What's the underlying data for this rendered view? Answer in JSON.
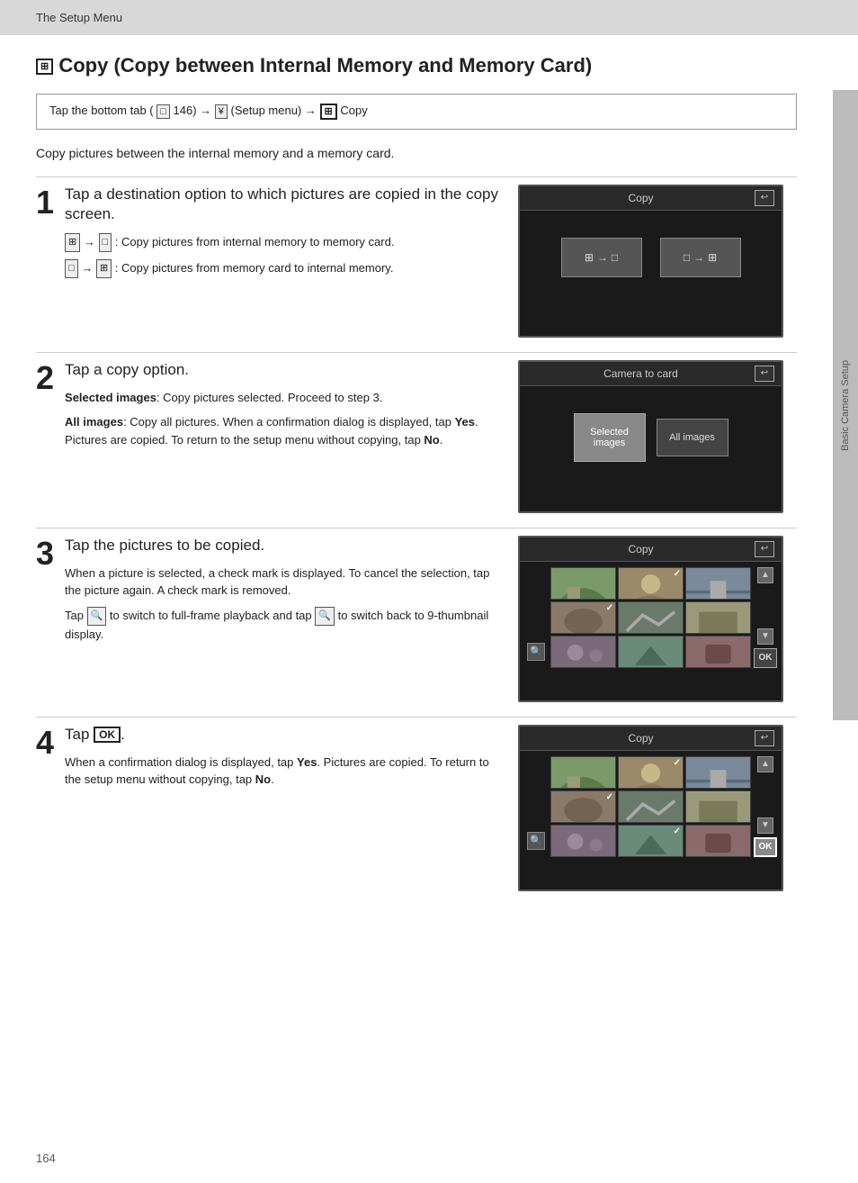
{
  "topBar": {
    "label": "The Setup Menu"
  },
  "page": {
    "title": "Copy (Copy between Internal Memory and Memory Card)",
    "titleIcon": "⊞",
    "instructionBox": "Tap the bottom tab (□ 146) → ¥ (Setup menu) → ⊞ Copy",
    "description": "Copy pictures between the internal memory and a memory card.",
    "sidebar": {
      "label": "Basic Camera Setup"
    },
    "pageNumber": "164"
  },
  "steps": [
    {
      "number": "1",
      "title": "Tap a destination option to which pictures are copied in the copy screen.",
      "descriptions": [
        "⊞ → □: Copy pictures from internal memory to memory card.",
        "□ → ⊞: Copy pictures from memory card to internal memory."
      ],
      "screen": {
        "title": "Copy",
        "options": [
          "⊞→□",
          "□→⊞"
        ]
      }
    },
    {
      "number": "2",
      "title": "Tap a copy option.",
      "descriptions": [
        "Selected images: Copy pictures selected. Proceed to step 3.",
        "All images: Copy all pictures. When a confirmation dialog is displayed, tap Yes. Pictures are copied. To return to the setup menu without copying, tap No."
      ],
      "screen": {
        "title": "Camera to card",
        "options": [
          "Selected images",
          "All images"
        ]
      }
    },
    {
      "number": "3",
      "title": "Tap the pictures to be copied.",
      "descriptions": [
        "When a picture is selected, a check mark is displayed. To cancel the selection, tap the picture again. A check mark is removed.",
        "Tap 🔍 to switch to full-frame playback and tap 🔍 to switch back to 9-thumbnail display."
      ],
      "screen": {
        "title": "Copy"
      }
    },
    {
      "number": "4",
      "title": "Tap OK.",
      "descriptions": [
        "When a confirmation dialog is displayed, tap Yes. Pictures are copied. To return to the setup menu without copying, tap No."
      ],
      "screen": {
        "title": "Copy"
      }
    }
  ]
}
